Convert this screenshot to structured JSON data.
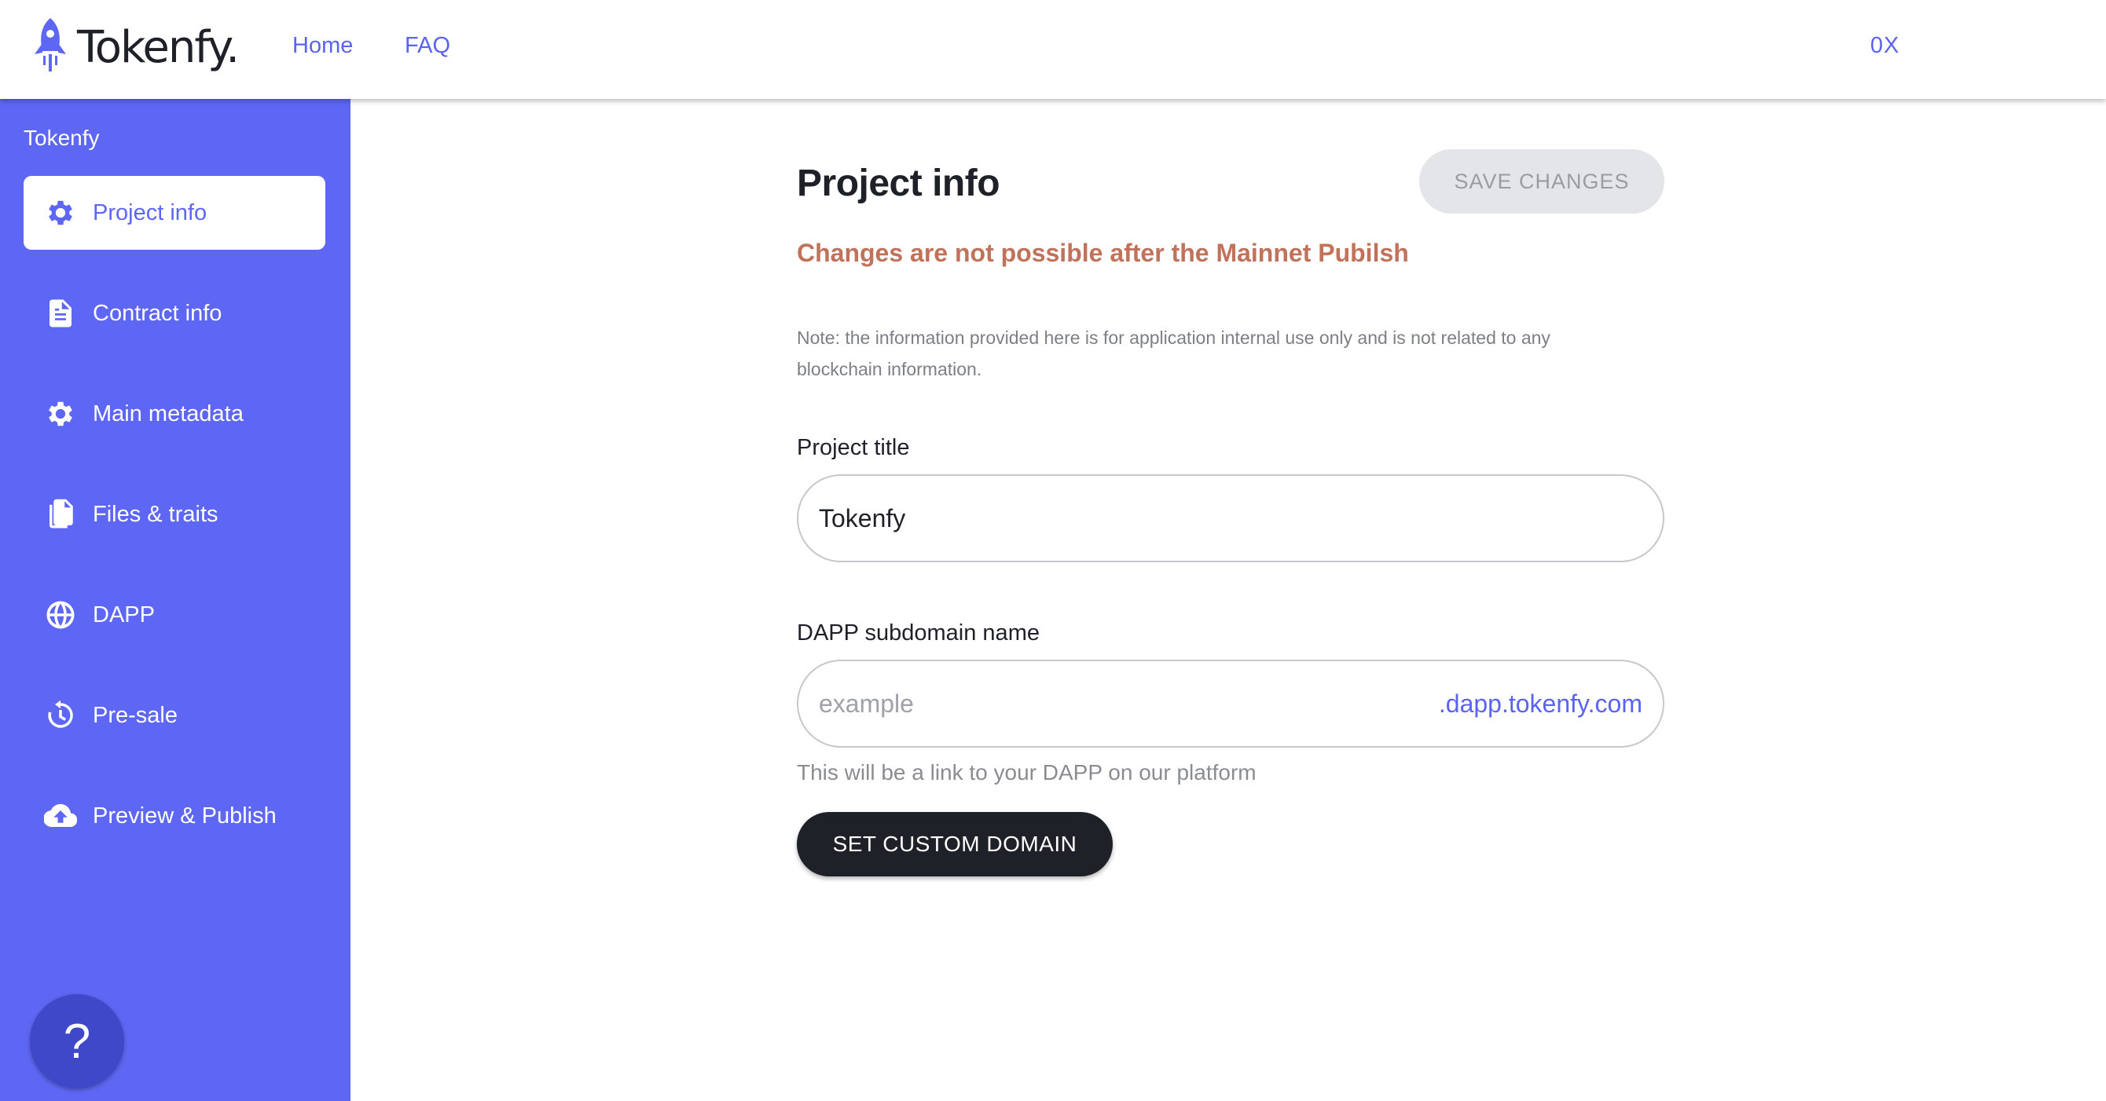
{
  "header": {
    "logo_text": "Tokenfy.",
    "nav": [
      {
        "label": "Home"
      },
      {
        "label": "FAQ"
      }
    ],
    "wallet": "0X"
  },
  "sidebar": {
    "title": "Tokenfy",
    "items": [
      {
        "label": "Project info",
        "icon": "gear-icon",
        "active": true
      },
      {
        "label": "Contract info",
        "icon": "document-icon"
      },
      {
        "label": "Main metadata",
        "icon": "gear-icon"
      },
      {
        "label": "Files & traits",
        "icon": "files-icon"
      },
      {
        "label": "DAPP",
        "icon": "globe-icon"
      },
      {
        "label": "Pre-sale",
        "icon": "clock-icon"
      },
      {
        "label": "Preview & Publish",
        "icon": "cloud-upload-icon"
      }
    ],
    "help_label": "?"
  },
  "main": {
    "title": "Project info",
    "save_label": "SAVE CHANGES",
    "warning": "Changes are not possible after the Mainnet Pubilsh",
    "note": "Note: the information provided here is for application internal use only and is not related to any blockchain information.",
    "project_title": {
      "label": "Project title",
      "value": "Tokenfy"
    },
    "subdomain": {
      "label": "DAPP subdomain name",
      "placeholder": "example",
      "suffix": ".dapp.tokenfy.com",
      "helper": "This will be a link to your DAPP on our platform"
    },
    "custom_domain_label": "SET CUSTOM DOMAIN"
  },
  "colors": {
    "sidebar": "#5e67f4",
    "accent": "#5b63f2",
    "warning": "#c0735a",
    "dark_button": "#1f2128",
    "disabled_button": "#e4e5e8"
  }
}
